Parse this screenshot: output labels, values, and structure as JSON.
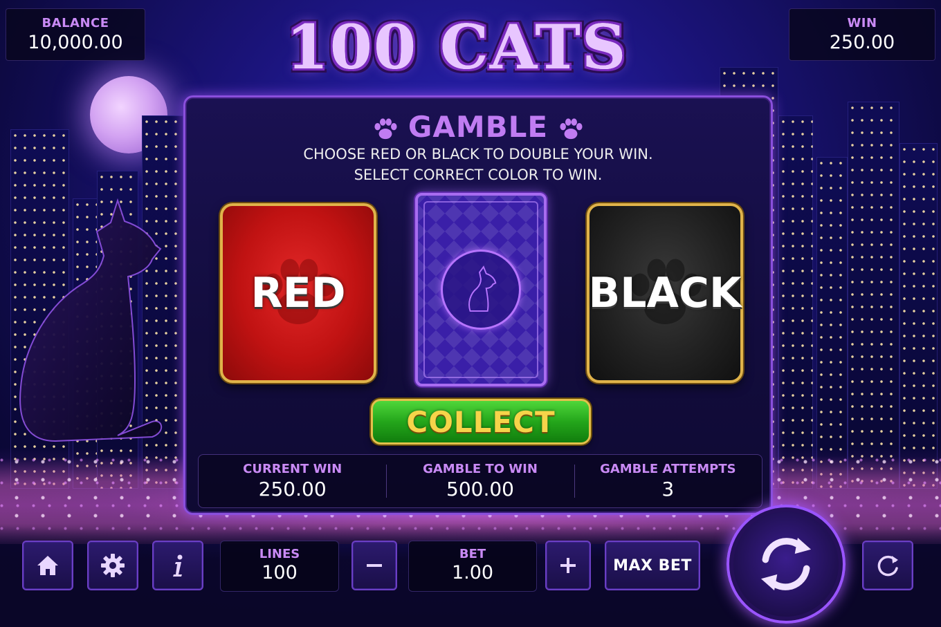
{
  "game": {
    "title": "100 CATS"
  },
  "hud": {
    "balance_label": "BALANCE",
    "balance_value": "10,000.00",
    "win_label": "WIN",
    "win_value": "250.00"
  },
  "gamble": {
    "title": "GAMBLE",
    "instruction_line1": "CHOOSE RED OR BLACK TO DOUBLE YOUR WIN.",
    "instruction_line2": "SELECT CORRECT COLOR TO WIN.",
    "red_label": "RED",
    "black_label": "BLACK",
    "collect_label": "COLLECT",
    "current_win_label": "CURRENT WIN",
    "current_win_value": "250.00",
    "gamble_to_win_label": "GAMBLE TO WIN",
    "gamble_to_win_value": "500.00",
    "attempts_label": "GAMBLE ATTEMPTS",
    "attempts_value": "3"
  },
  "controls": {
    "lines_label": "LINES",
    "lines_value": "100",
    "bet_label": "BET",
    "bet_value": "1.00",
    "max_bet_label": "MAX BET",
    "icons": [
      "home-icon",
      "gear-icon",
      "info-icon",
      "minus-icon",
      "plus-icon",
      "spin-icon",
      "autoplay-refresh-icon"
    ]
  },
  "colors": {
    "accent_purple": "#c98af5",
    "panel_border": "#8a4fdc",
    "red_card": "#c01212",
    "black_card": "#202020",
    "collect_green": "#24a61b",
    "gold": "#e0b34a"
  }
}
